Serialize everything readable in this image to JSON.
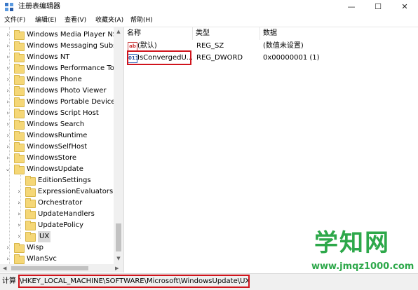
{
  "window": {
    "title": "注册表编辑器",
    "buttons": {
      "minimize": "—",
      "maximize": "☐",
      "close": "✕"
    }
  },
  "menu": [
    "文件(F)",
    "编辑(E)",
    "查看(V)",
    "收藏夹(A)",
    "帮助(H)"
  ],
  "tree": {
    "items": [
      {
        "label": "Windows Media Player NS",
        "chevron": "›",
        "level": 1
      },
      {
        "label": "Windows Messaging Subs",
        "chevron": "›",
        "level": 1
      },
      {
        "label": "Windows NT",
        "chevron": "›",
        "level": 1
      },
      {
        "label": "Windows Performance Too",
        "chevron": "›",
        "level": 1
      },
      {
        "label": "Windows Phone",
        "chevron": "›",
        "level": 1
      },
      {
        "label": "Windows Photo Viewer",
        "chevron": "›",
        "level": 1
      },
      {
        "label": "Windows Portable Devices",
        "chevron": "›",
        "level": 1
      },
      {
        "label": "Windows Script Host",
        "chevron": "›",
        "level": 1
      },
      {
        "label": "Windows Search",
        "chevron": "›",
        "level": 1
      },
      {
        "label": "WindowsRuntime",
        "chevron": "›",
        "level": 1
      },
      {
        "label": "WindowsSelfHost",
        "chevron": "›",
        "level": 1
      },
      {
        "label": "WindowsStore",
        "chevron": "›",
        "level": 1
      },
      {
        "label": "WindowsUpdate",
        "chevron": "⌄",
        "level": 1
      },
      {
        "label": "EditionSettings",
        "chevron": "",
        "level": 2
      },
      {
        "label": "ExpressionEvaluators",
        "chevron": "›",
        "level": 2
      },
      {
        "label": "Orchestrator",
        "chevron": "›",
        "level": 2
      },
      {
        "label": "UpdateHandlers",
        "chevron": "›",
        "level": 2
      },
      {
        "label": "UpdatePolicy",
        "chevron": "›",
        "level": 2
      },
      {
        "label": "UX",
        "chevron": "›",
        "level": 2,
        "selected": true
      },
      {
        "label": "Wisp",
        "chevron": "›",
        "level": 1
      },
      {
        "label": "WlanSvc",
        "chevron": "›",
        "level": 1
      }
    ]
  },
  "list": {
    "headers": {
      "name": "名称",
      "type": "类型",
      "data": "数据"
    },
    "rows": [
      {
        "name": "(默认)",
        "type": "REG_SZ",
        "data": "(数值未设置)",
        "icon": "ab"
      },
      {
        "name": "IsConvergedU...",
        "type": "REG_DWORD",
        "data": "0x00000001 (1)",
        "icon": "011"
      }
    ]
  },
  "statusbar": {
    "prefix": "计算",
    "path": "\\HKEY_LOCAL_MACHINE\\SOFTWARE\\Microsoft\\WindowsUpdate\\UX"
  },
  "watermark": {
    "main": "学知网",
    "sub": "www.jmqz1000.com"
  },
  "colors": {
    "highlight": "#d0141c",
    "watermark": "#2da84a",
    "folder": "#f5d777"
  }
}
